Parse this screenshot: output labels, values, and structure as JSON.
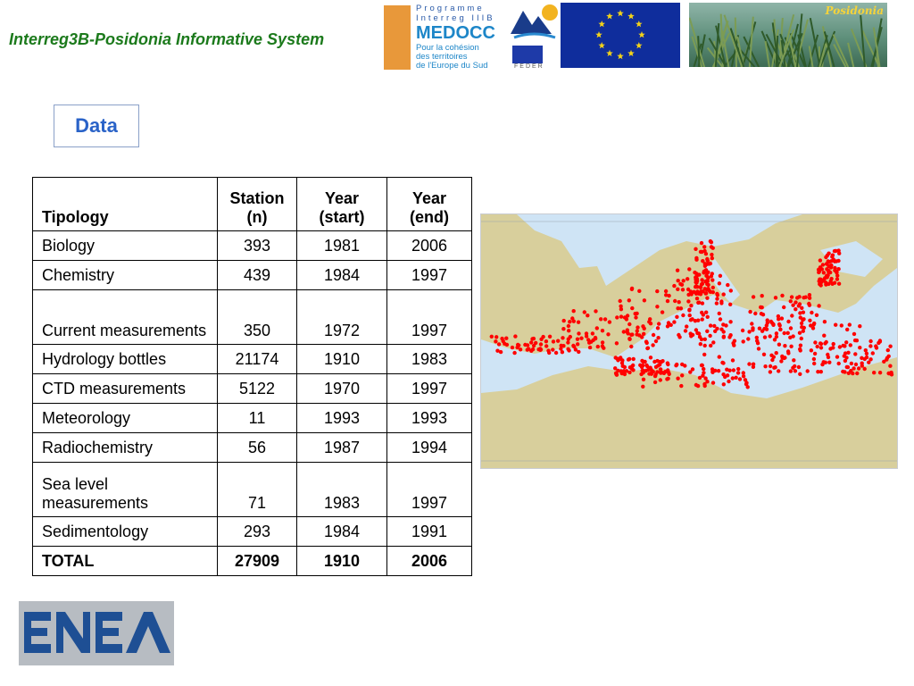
{
  "header": {
    "title": "Interreg3B-Posidonia Informative System"
  },
  "logos": {
    "medocc_program": "Programme",
    "medocc_program2": "Interreg IIIB",
    "medocc_name": "MEDOCC",
    "medocc_sub1": "Pour la cohésion",
    "medocc_sub2": "des territoires",
    "medocc_sub3": "de l'Europe du Sud",
    "feder": "FEDER",
    "posidonia": "Posidonia",
    "enea": "ENEA",
    "colors": {
      "eu_blue": "#0f2d9c",
      "eu_star": "#f2d21a",
      "enea_blue": "#1e4f94",
      "medocc_orange": "#e8983a"
    }
  },
  "section": {
    "title": "Data"
  },
  "table": {
    "headers": [
      "Tipology",
      "Station (n)",
      "Year (start)",
      "Year (end)"
    ],
    "header_lines": [
      [
        "Tipology"
      ],
      [
        "Station",
        "(n)"
      ],
      [
        "Year",
        "(start)"
      ],
      [
        "Year",
        "(end)"
      ]
    ],
    "rows": [
      {
        "tipology": "Biology",
        "station": "393",
        "start": "1981",
        "end": "2006"
      },
      {
        "tipology": "Chemistry",
        "station": "439",
        "start": "1984",
        "end": "1997"
      },
      {
        "tipology": "Current measurements",
        "station": "350",
        "start": "1972",
        "end": "1997"
      },
      {
        "tipology": "Hydrology bottles",
        "station": "21174",
        "start": "1910",
        "end": "1983"
      },
      {
        "tipology": "CTD measurements",
        "station": "5122",
        "start": "1970",
        "end": "1997"
      },
      {
        "tipology": "Meteorology",
        "station": "11",
        "start": "1993",
        "end": "1993"
      },
      {
        "tipology": "Radiochemistry",
        "station": "56",
        "start": "1987",
        "end": "1994"
      },
      {
        "tipology": "Sea level measurements",
        "station": "71",
        "start": "1983",
        "end": "1997"
      },
      {
        "tipology": "Sedimentology",
        "station": "293",
        "start": "1984",
        "end": "1991"
      }
    ],
    "total": {
      "label": "TOTAL",
      "station": "27909",
      "start": "1910",
      "end": "2006"
    }
  },
  "map": {
    "colors": {
      "sea": "#cfe4f5",
      "land": "#d8cf9c",
      "coast": "#8fc3e3",
      "station": "#ff0000"
    }
  }
}
